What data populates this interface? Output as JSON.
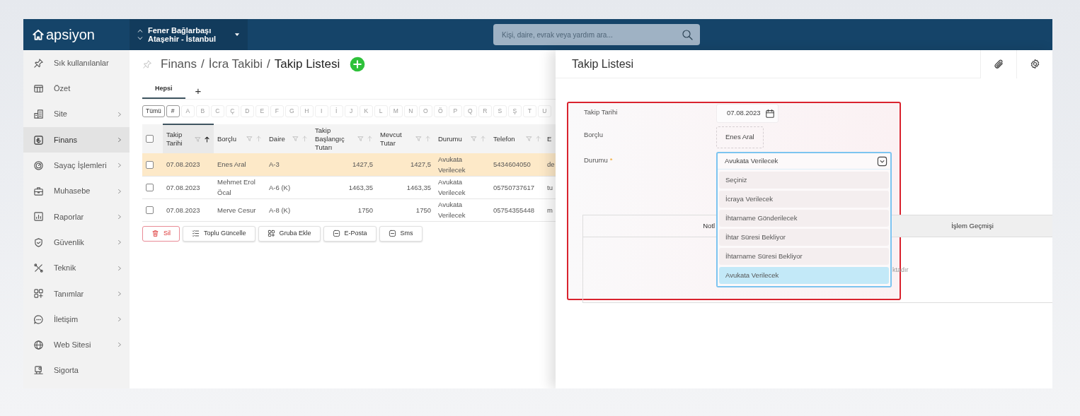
{
  "header": {
    "logo": "apsiyon",
    "site": {
      "name": "Fener Bağlarbaşı",
      "location": "Ataşehir - İstanbul"
    },
    "search": {
      "placeholder": "Kişi, daire, evrak veya yardım ara..."
    }
  },
  "sidebar": {
    "items": [
      {
        "label": "Sık kullanılanlar",
        "selected": false,
        "has_submenu": false
      },
      {
        "label": "Özet",
        "selected": false,
        "has_submenu": false
      },
      {
        "label": "Site",
        "selected": false,
        "has_submenu": true
      },
      {
        "label": "Finans",
        "selected": true,
        "has_submenu": true
      },
      {
        "label": "Sayaç İşlemleri",
        "selected": false,
        "has_submenu": true
      },
      {
        "label": "Muhasebe",
        "selected": false,
        "has_submenu": true
      },
      {
        "label": "Raporlar",
        "selected": false,
        "has_submenu": true
      },
      {
        "label": "Güvenlik",
        "selected": false,
        "has_submenu": true
      },
      {
        "label": "Teknik",
        "selected": false,
        "has_submenu": true
      },
      {
        "label": "Tanımlar",
        "selected": false,
        "has_submenu": true
      },
      {
        "label": "İletişim",
        "selected": false,
        "has_submenu": true
      },
      {
        "label": "Web Sitesi",
        "selected": false,
        "has_submenu": true
      },
      {
        "label": "Sigorta",
        "selected": false,
        "has_submenu": false
      }
    ]
  },
  "breadcrumb": {
    "items": [
      "Finans",
      "İcra Takibi",
      "Takip Listesi"
    ],
    "separator": "/"
  },
  "view_tabs": [
    {
      "label": "Hepsi",
      "selected": true
    }
  ],
  "add_tab": "+",
  "letter_filter": [
    {
      "label": "Tümü",
      "disabled": false
    },
    {
      "label": "#",
      "disabled": false
    },
    {
      "label": "A",
      "disabled": true
    },
    {
      "label": "B",
      "disabled": true
    },
    {
      "label": "C",
      "disabled": true
    },
    {
      "label": "Ç",
      "disabled": true
    },
    {
      "label": "D",
      "disabled": true
    },
    {
      "label": "E",
      "disabled": true
    },
    {
      "label": "F",
      "disabled": true
    },
    {
      "label": "G",
      "disabled": true
    },
    {
      "label": "H",
      "disabled": true
    },
    {
      "label": "I",
      "disabled": true
    },
    {
      "label": "İ",
      "disabled": true
    },
    {
      "label": "J",
      "disabled": true
    },
    {
      "label": "K",
      "disabled": true
    },
    {
      "label": "L",
      "disabled": true
    },
    {
      "label": "M",
      "disabled": true
    },
    {
      "label": "N",
      "disabled": true
    },
    {
      "label": "O",
      "disabled": true
    },
    {
      "label": "Ö",
      "disabled": true
    },
    {
      "label": "P",
      "disabled": true
    },
    {
      "label": "Q",
      "disabled": true
    },
    {
      "label": "R",
      "disabled": true
    },
    {
      "label": "S",
      "disabled": true
    },
    {
      "label": "Ş",
      "disabled": true
    },
    {
      "label": "T",
      "disabled": true
    },
    {
      "label": "U",
      "disabled": true
    }
  ],
  "table": {
    "select_all": {
      "checked": false
    },
    "columns": [
      {
        "label": "Takip Tarihi",
        "kind": "text",
        "sorted": true
      },
      {
        "label": "Borçlu",
        "kind": "text",
        "sorted": false
      },
      {
        "label": "Daire",
        "kind": "text",
        "sorted": false
      },
      {
        "label": "Takip Başlangıç Tutarı",
        "kind": "number",
        "sorted": false
      },
      {
        "label": "Mevcut Tutar",
        "kind": "number",
        "sorted": false
      },
      {
        "label": "Durumu",
        "kind": "text",
        "sorted": false
      },
      {
        "label": "Telefon",
        "kind": "text",
        "sorted": false
      },
      {
        "label": "E",
        "kind": "cut",
        "sorted": false
      }
    ],
    "rows": [
      {
        "selected": true,
        "checked": false,
        "cells": [
          "07.08.2023",
          "Enes Aral",
          "A-3",
          "1427,5",
          "1427,5",
          "Avukata Verilecek",
          "5434604050",
          "de"
        ]
      },
      {
        "selected": false,
        "checked": false,
        "cells": [
          "07.08.2023",
          "Mehmet Erol Öcal",
          "A-6 (K)",
          "1463,35",
          "1463,35",
          "Avukata Verilecek",
          "05750737617",
          "tu"
        ]
      },
      {
        "selected": false,
        "checked": false,
        "cells": [
          "07.08.2023",
          "Merve Cesur",
          "A-8 (K)",
          "1750",
          "1750",
          "Avukata Verilecek",
          "05754355448",
          "m"
        ]
      }
    ]
  },
  "actions": [
    {
      "label": "Sil",
      "kind": "danger"
    },
    {
      "label": "Toplu Güncelle",
      "kind": "normal"
    },
    {
      "label": "Gruba Ekle",
      "kind": "normal"
    },
    {
      "label": "E-Posta",
      "kind": "normal"
    },
    {
      "label": "Sms",
      "kind": "normal"
    }
  ],
  "detail_panel": {
    "title": "Takip Listesi",
    "highlighted": true,
    "fields": [
      {
        "label": "Takip Tarihi",
        "kind": "date",
        "value": "07.08.2023"
      },
      {
        "label": "Borçlu",
        "kind": "readonly",
        "value": "Enes Aral"
      },
      {
        "label": "Durumu",
        "kind": "select",
        "required_mark": "*",
        "value": "Avukata Verilecek",
        "expanded": true,
        "options": [
          {
            "label": "Seçiniz",
            "selected": false
          },
          {
            "label": "İcraya Verilecek",
            "selected": false
          },
          {
            "label": "İhtarname Gönderilecek",
            "selected": false
          },
          {
            "label": "İhtar Süresi Bekliyor",
            "selected": false
          },
          {
            "label": "İhtarname Süresi Bekliyor",
            "selected": false
          },
          {
            "label": "Avukata Verilecek",
            "selected": true
          }
        ]
      }
    ],
    "notes_tabs": [
      {
        "label": "Notl",
        "selected": true
      },
      {
        "label": "İşlem Geçmişi",
        "selected": false
      }
    ],
    "notes_message": "ktadır"
  }
}
